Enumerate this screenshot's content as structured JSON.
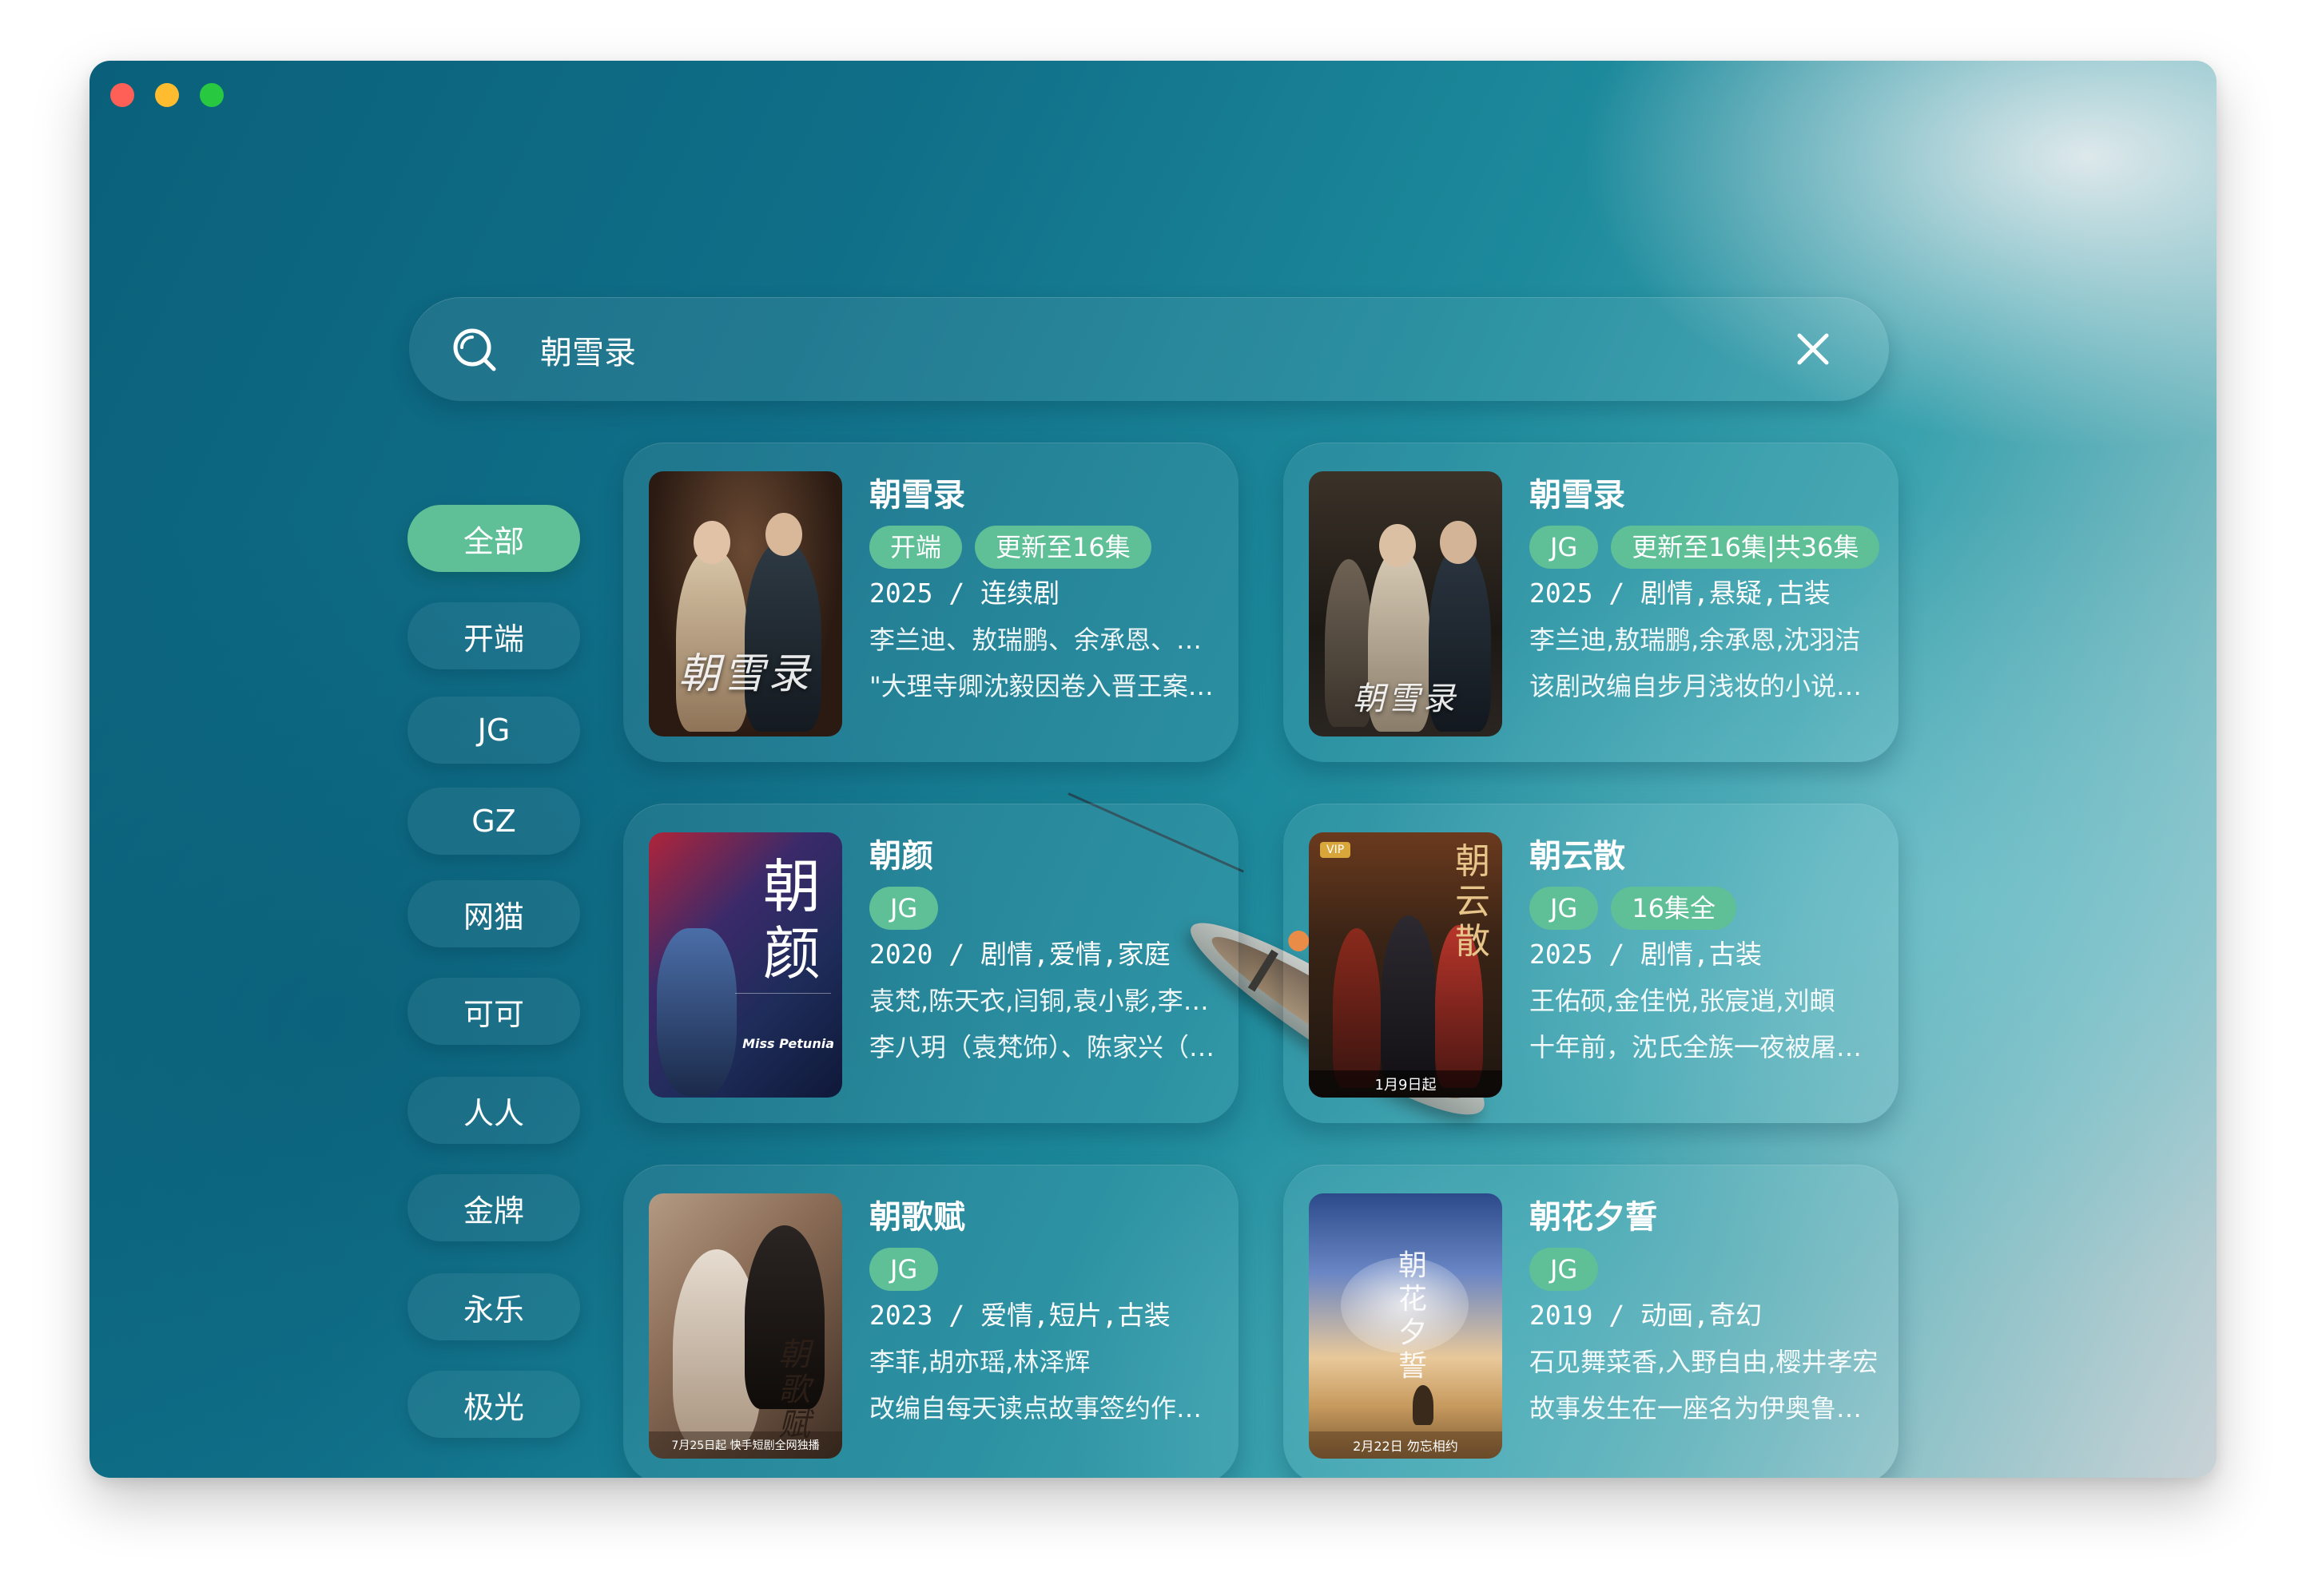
{
  "window": {
    "controls": [
      "close",
      "minimize",
      "zoom"
    ]
  },
  "search": {
    "query": "朝雪录",
    "icon": "search-icon",
    "clear_icon": "close-icon"
  },
  "colors": {
    "accent": "#5fbf97",
    "text": "#ffffff"
  },
  "filters": [
    {
      "label": "全部",
      "active": true
    },
    {
      "label": "开端",
      "active": false
    },
    {
      "label": "JG",
      "active": false
    },
    {
      "label": "GZ",
      "active": false
    },
    {
      "label": "网猫",
      "active": false
    },
    {
      "label": "可可",
      "active": false
    },
    {
      "label": "人人",
      "active": false
    },
    {
      "label": "金牌",
      "active": false
    },
    {
      "label": "永乐",
      "active": false
    },
    {
      "label": "极光",
      "active": false
    }
  ],
  "results": [
    {
      "title": "朝雪录",
      "badges": [
        "开端",
        "更新至16集"
      ],
      "meta": "2025 / 连续剧",
      "cast": "李兰迪、敖瑞鹏、余承恩、沈羽洁",
      "desc": "\"大理寺卿沈毅因卷入晋王案而被抄家",
      "poster_text": "朝雪录"
    },
    {
      "title": "朝雪录",
      "badges": [
        "JG",
        "更新至16集|共36集"
      ],
      "meta": "2025 / 剧情,悬疑,古装",
      "cast": "李兰迪,敖瑞鹏,余承恩,沈羽洁",
      "desc": "该剧改编自步月浅妆的小说《朝雪录》",
      "poster_text": "朝雪录"
    },
    {
      "title": "朝颜",
      "badges": [
        "JG"
      ],
      "meta": "2020 / 剧情,爱情,家庭",
      "cast": "袁梵,陈天衣,闫铜,袁小影,李八玥",
      "desc": "李八玥（袁梵饰）、陈家兴（陈天衣饰）",
      "poster_text": "朝颜",
      "poster_sub": "Miss Petunia"
    },
    {
      "title": "朝云散",
      "badges": [
        "JG",
        "16集全"
      ],
      "meta": "2025 / 剧情,古装",
      "cast": "王佑硕,金佳悦,张宸逍,刘頔",
      "desc": "十年前，沈氏全族一夜被屠，唯一幸存",
      "poster_text": "朝云散",
      "poster_date": "1月9日起"
    },
    {
      "title": "朝歌赋",
      "badges": [
        "JG"
      ],
      "meta": "2023 / 爱情,短片,古装",
      "cast": "李菲,胡亦瑶,林泽辉",
      "desc": "改编自每天读点故事签约作者同名小说",
      "poster_text": "朝歌赋",
      "poster_date": "7月25日起 快手短剧全网独播"
    },
    {
      "title": "朝花夕誓",
      "badges": [
        "JG"
      ],
      "meta": "2019 / 动画,奇幻",
      "cast": "石见舞菜香,入野自由,樱井孝宏",
      "desc": "故事发生在一座名为伊奥鲁夫的村落",
      "poster_text": "朝花夕誓",
      "poster_date": "2月22日 勿忘相约"
    }
  ]
}
